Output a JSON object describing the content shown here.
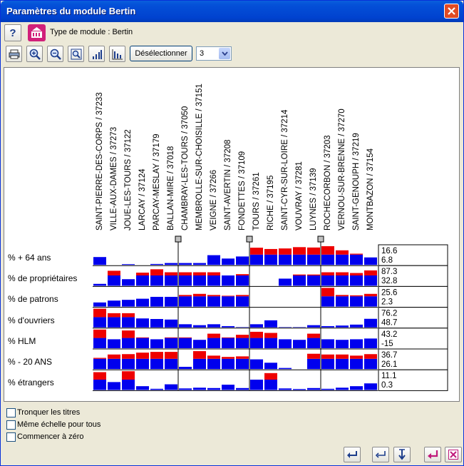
{
  "window": {
    "title": "Paramètres du module Bertin"
  },
  "header": {
    "module_type": "Type de module : Bertin"
  },
  "toolbar": {
    "deselect_label": "Désélectionner",
    "combo_value": "3"
  },
  "colors": {
    "above": "#ee0000",
    "below": "#0000ee"
  },
  "communes": [
    "SAINT-PIERRE-DES-CORPS / 37233",
    "VILLE-AUX-DAMES / 37273",
    "JOUE-LES-TOURS / 37122",
    "LARCAY / 37124",
    "PARCAY-MESLAY / 37179",
    "BALLAN-MIRE / 37018",
    "CHAMBRAY-LES-TOURS / 37050",
    "MEMBROLLE-SUR-CHOISILLE / 37151",
    "VEIGNE / 37266",
    "SAINT-AVERTIN / 37208",
    "FONDETTES / 37109",
    "TOURS / 37261",
    "RICHE / 37195",
    "SAINT-CYR-SUR-LOIRE / 37214",
    "VOUVRAY / 37281",
    "LUYNES / 37139",
    "ROCHECORBON / 37203",
    "VERNOU-SUR-BRENNE / 37270",
    "SAINT-GENOUPH / 37219",
    "MONTBAZON / 37154"
  ],
  "rows": [
    {
      "label": "% + 64 ans",
      "max": "16.6",
      "min": "6.8"
    },
    {
      "label": "% de propriétaires",
      "max": "87.3",
      "min": "32.8"
    },
    {
      "label": "% de patrons",
      "max": "25.6",
      "min": "2.3"
    },
    {
      "label": "% d'ouvriers",
      "max": "76.2",
      "min": "48.7"
    },
    {
      "label": "% HLM",
      "max": "43.2",
      "min": "-15"
    },
    {
      "label": "% - 20 ANS",
      "max": "36.7",
      "min": "26.1"
    },
    {
      "label": "% étrangers",
      "max": "11.1",
      "min": "0.3"
    }
  ],
  "matrix": [
    [
      0.42,
      0.0,
      0.04,
      0.0,
      0.05,
      0.1,
      0.1,
      0.1,
      0.52,
      0.34,
      0.45,
      0.92,
      0.85,
      0.88,
      0.95,
      0.93,
      1.0,
      0.78,
      0.6,
      0.4
    ],
    [
      0.1,
      0.8,
      0.35,
      0.7,
      0.88,
      0.72,
      0.72,
      0.72,
      0.72,
      0.55,
      0.62,
      0.0,
      0.0,
      0.38,
      0.6,
      0.6,
      0.72,
      0.72,
      0.68,
      0.82
    ],
    [
      0.22,
      0.32,
      0.36,
      0.42,
      0.52,
      0.52,
      0.62,
      0.68,
      0.62,
      0.58,
      0.62,
      0.0,
      0.0,
      0.0,
      0.0,
      0.0,
      1.0,
      0.62,
      0.6,
      0.68
    ],
    [
      1.0,
      0.76,
      0.76,
      0.48,
      0.45,
      0.42,
      0.17,
      0.12,
      0.17,
      0.07,
      0.02,
      0.17,
      0.38,
      0.02,
      0.02,
      0.12,
      0.07,
      0.1,
      0.15,
      0.46
    ],
    [
      1.0,
      0.48,
      0.95,
      0.58,
      0.48,
      0.58,
      0.58,
      0.45,
      0.78,
      0.58,
      0.72,
      0.88,
      0.82,
      0.48,
      0.45,
      0.78,
      0.48,
      0.45,
      0.48,
      0.52
    ],
    [
      0.6,
      0.78,
      0.8,
      0.88,
      0.92,
      0.92,
      0.12,
      0.96,
      0.72,
      0.65,
      0.68,
      0.52,
      0.34,
      0.06,
      0.0,
      0.82,
      0.78,
      0.78,
      0.72,
      0.8
    ],
    [
      0.95,
      0.42,
      1.0,
      0.2,
      0.06,
      0.3,
      0.08,
      0.12,
      0.1,
      0.28,
      0.1,
      0.55,
      0.9,
      0.08,
      0.05,
      0.1,
      0.06,
      0.12,
      0.2,
      0.35
    ]
  ],
  "options": [
    {
      "label": "Tronquer les titres"
    },
    {
      "label": "Même échelle pour tous"
    },
    {
      "label": "Commencer à zéro"
    }
  ]
}
